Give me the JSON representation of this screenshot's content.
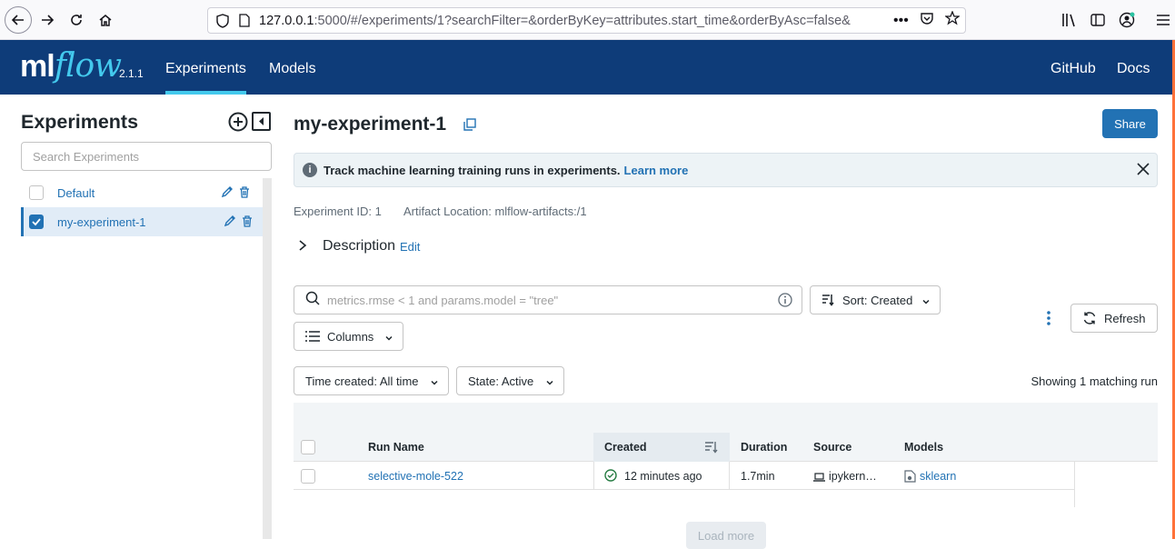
{
  "browser": {
    "url_host": "127.0.0.1",
    "url_rest": ":5000/#/experiments/1?searchFilter=&orderByKey=attributes.start_time&orderByAsc=false&",
    "more": "•••"
  },
  "header": {
    "logo_ml": "ml",
    "logo_flow": "flow",
    "version": "2.1.1",
    "nav": {
      "experiments": "Experiments",
      "models": "Models",
      "github": "GitHub",
      "docs": "Docs"
    },
    "accent": "#43c9ed",
    "bg": "#0e3c79"
  },
  "sidebar": {
    "title": "Experiments",
    "search_placeholder": "Search Experiments",
    "experiments": [
      {
        "name": "Default",
        "checked": false
      },
      {
        "name": "my-experiment-1",
        "checked": true
      }
    ]
  },
  "main": {
    "title": "my-experiment-1",
    "share_label": "Share",
    "banner": {
      "text": "Track machine learning training runs in experiments.",
      "link": "Learn more",
      "info_glyph": "i"
    },
    "meta": {
      "experiment_id": "Experiment ID: 1",
      "artifact_location": "Artifact Location: mlflow-artifacts:/1"
    },
    "description": {
      "label": "Description",
      "edit": "Edit"
    },
    "search_placeholder": "metrics.rmse < 1 and params.model = \"tree\"",
    "sort_label": "Sort: Created",
    "columns_label": "Columns",
    "refresh_label": "Refresh",
    "time_filter": "Time created: All time",
    "state_filter": "State: Active",
    "showing": "Showing 1 matching run",
    "load_more": "Load more",
    "primary": "#2272b4"
  },
  "table": {
    "headers": {
      "run_name": "Run Name",
      "created": "Created",
      "duration": "Duration",
      "source": "Source",
      "models": "Models"
    },
    "rows": [
      {
        "run_name": "selective-mole-522",
        "created": "12 minutes ago",
        "duration": "1.7min",
        "source": "ipykern…",
        "models": "sklearn",
        "status": "finished"
      }
    ]
  }
}
